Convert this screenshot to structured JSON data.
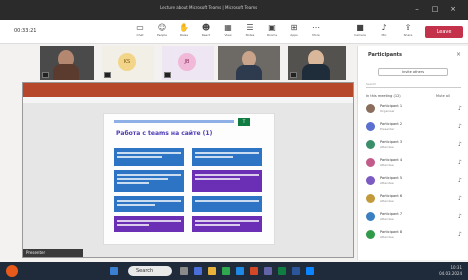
{
  "window": {
    "title": "Lecture about Microsoft Teams | Microsoft Teams"
  },
  "toolbar": {
    "meeting_label": "00:33:21",
    "items": [
      {
        "label": "Chat",
        "icon": "chat-icon"
      },
      {
        "label": "People",
        "icon": "people-icon"
      },
      {
        "label": "Raise",
        "icon": "hand-icon"
      },
      {
        "label": "React",
        "icon": "react-icon"
      },
      {
        "label": "View",
        "icon": "view-icon"
      },
      {
        "label": "Notes",
        "icon": "notes-icon"
      },
      {
        "label": "Rooms",
        "icon": "rooms-icon"
      },
      {
        "label": "Apps",
        "icon": "apps-icon"
      },
      {
        "label": "More",
        "icon": "more-icon"
      },
      {
        "label": "Camera",
        "icon": "camera-icon"
      },
      {
        "label": "Mic",
        "icon": "mic-icon"
      },
      {
        "label": "Share",
        "icon": "share-icon"
      }
    ],
    "leave_label": "Leave"
  },
  "participants_strip": {
    "avatar_initials": [
      "KS",
      "JB"
    ]
  },
  "shared_content": {
    "slide_title": "Работа с teams на сайте (1)",
    "badge": "T",
    "caption": "Presenter"
  },
  "panel": {
    "title": "Participants",
    "invite_label": "Invite others",
    "search_placeholder": "Search",
    "in_meeting_label": "In this meeting (12)",
    "mute_all_label": "Mute all",
    "people": [
      {
        "name": "Participant 1",
        "status": "Organiser",
        "color": "#8a6d5b"
      },
      {
        "name": "Participant 2",
        "status": "Presenter",
        "color": "#5b6fd0"
      },
      {
        "name": "Participant 3",
        "status": "Attendee",
        "color": "#3a8f6a"
      },
      {
        "name": "Participant 4",
        "status": "Attendee",
        "color": "#c25b8a"
      },
      {
        "name": "Participant 5",
        "status": "Attendee",
        "color": "#7b5bc2"
      },
      {
        "name": "Participant 6",
        "status": "Attendee",
        "color": "#c29a3a"
      },
      {
        "name": "Participant 7",
        "status": "Attendee",
        "color": "#3a7fc2"
      },
      {
        "name": "Participant 8",
        "status": "Attendee",
        "color": "#2f9a4a"
      }
    ]
  },
  "taskbar": {
    "search_label": "Search",
    "time": "10:31",
    "date": "04.03.2024"
  },
  "colors": {
    "leave": "#c4314b",
    "ppt_ribbon": "#b7472a",
    "slide_blue": "#2e74c4",
    "slide_purple": "#6b2fb5"
  }
}
